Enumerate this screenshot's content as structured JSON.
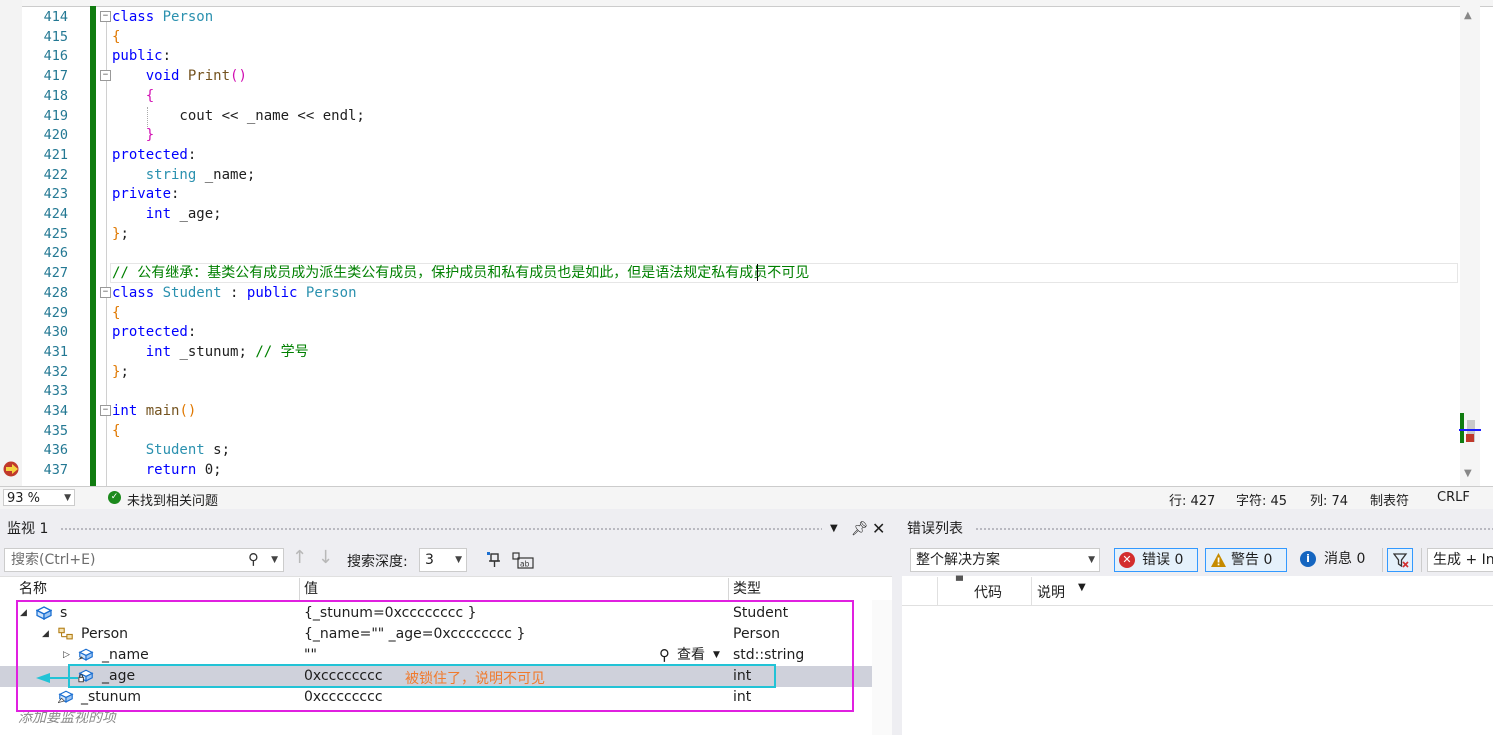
{
  "editor": {
    "lines": [
      {
        "no": "414",
        "html": "<span class=\"kw\">class</span> <span class=\"ty\">Person</span>"
      },
      {
        "no": "415",
        "html": "<span class=\"br\">{</span>"
      },
      {
        "no": "416",
        "html": "<span class=\"kw\">public</span>:"
      },
      {
        "no": "417",
        "html": "    <span class=\"kw\">void</span> <span class=\"fn\">Print</span><span class=\"br2\">()</span>"
      },
      {
        "no": "418",
        "html": "    <span class=\"br2\">{</span>"
      },
      {
        "no": "419",
        "html": "        cout &lt;&lt; _name &lt;&lt; endl;"
      },
      {
        "no": "420",
        "html": "    <span class=\"br2\">}</span>"
      },
      {
        "no": "421",
        "html": "<span class=\"kw\">protected</span>:"
      },
      {
        "no": "422",
        "html": "    <span class=\"ty\">string</span> _name;"
      },
      {
        "no": "423",
        "html": "<span class=\"kw\">private</span>:"
      },
      {
        "no": "424",
        "html": "    <span class=\"kw\">int</span> _age;"
      },
      {
        "no": "425",
        "html": "<span class=\"br\">}</span>;"
      },
      {
        "no": "426",
        "html": ""
      },
      {
        "no": "427",
        "html": "<span class=\"cm\">// 公有继承：基类公有成员成为派生类公有成员，保护成员和私有成员也是如此，但是语法规定私有成员不可见</span>"
      },
      {
        "no": "428",
        "html": "<span class=\"kw\">class</span> <span class=\"ty\">Student</span> : <span class=\"kw\">public</span> <span class=\"ty\">Person</span>"
      },
      {
        "no": "429",
        "html": "<span class=\"br\">{</span>"
      },
      {
        "no": "430",
        "html": "<span class=\"kw\">protected</span>:"
      },
      {
        "no": "431",
        "html": "    <span class=\"kw\">int</span> _stunum; <span class=\"cm\">// 学号</span>"
      },
      {
        "no": "432",
        "html": "<span class=\"br\">}</span>;"
      },
      {
        "no": "433",
        "html": ""
      },
      {
        "no": "434",
        "html": "<span class=\"kw\">int</span> <span class=\"fn\">main</span><span class=\"br\">()</span>"
      },
      {
        "no": "435",
        "html": "<span class=\"br\">{</span>"
      },
      {
        "no": "436",
        "html": "    <span class=\"ty\">Student</span> s;"
      },
      {
        "no": "437",
        "html": "    <span class=\"kw\">return</span> 0;"
      }
    ]
  },
  "status": {
    "zoom": "93 %",
    "issues": "未找到相关问题",
    "line": "行: 427",
    "char": "字符: 45",
    "col": "列: 74",
    "tabs": "制表符",
    "eol": "CRLF"
  },
  "watch": {
    "title": "监视 1",
    "search_placeholder": "搜索(Ctrl+E)",
    "depth_label": "搜索深度:",
    "depth_value": "3",
    "col_name": "名称",
    "col_value": "值",
    "col_type": "类型",
    "rows": [
      {
        "name": "s",
        "value": "{_stunum=0xcccccccc }",
        "type": "Student"
      },
      {
        "name": "Person",
        "value": "{_name=\"\" _age=0xcccccccc }",
        "type": "Person"
      },
      {
        "name": "_name",
        "value": "\"\"",
        "type": "std::string"
      },
      {
        "name": "_age",
        "value": "0xcccccccc",
        "type": "int"
      },
      {
        "name": "_stunum",
        "value": "0xcccccccc",
        "type": "int"
      }
    ],
    "view_label": "查看",
    "add_item": "添加要监视的项",
    "annotation": "被锁住了，说明不可见"
  },
  "errors": {
    "title": "错误列表",
    "scope": "整个解决方案",
    "errors_label": "错误 0",
    "warnings_label": "警告 0",
    "messages_label": "消息 0",
    "build_label": "生成 + In",
    "col_code": "代码",
    "col_desc": "说明"
  },
  "colors": {
    "keyword": "#0000ff",
    "type": "#2b91af",
    "comment": "#008000",
    "annotation_box": "#e020e0",
    "highlight_box": "#22c3d6",
    "annotation_text": "#f07a2d"
  }
}
